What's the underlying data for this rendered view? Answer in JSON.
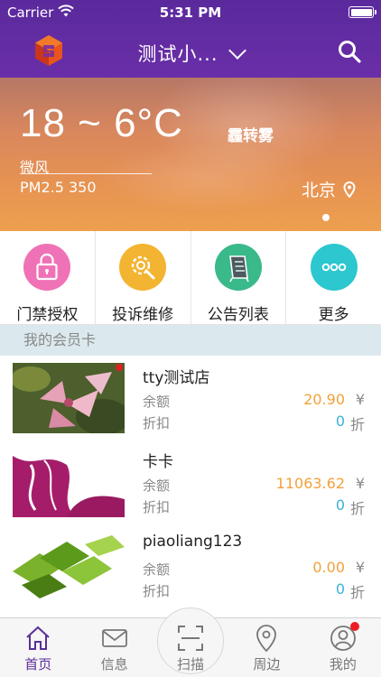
{
  "status_bar": {
    "carrier": "Carrier",
    "time": "5:31 PM"
  },
  "header": {
    "store_name": "测试小...",
    "icons": [
      "logo-icon",
      "chevron-down-icon",
      "search-icon"
    ]
  },
  "weather": {
    "temperature": "18 ~ 6°C",
    "condition": "霾转雾",
    "wind": "微风",
    "pm25": "PM2.5 350",
    "city": "北京"
  },
  "quick_actions": [
    {
      "label": "门禁授权",
      "icon": "lock-icon",
      "color": "#f072b6"
    },
    {
      "label": "投诉维修",
      "icon": "gear-wrench-icon",
      "color": "#f3b431"
    },
    {
      "label": "公告列表",
      "icon": "notice-board-icon",
      "color": "#3ab98a"
    },
    {
      "label": "更多",
      "icon": "more-icon",
      "color": "#2cc7cf"
    }
  ],
  "section": {
    "title": "我的会员卡"
  },
  "cards": [
    {
      "name": "tty测试店",
      "balance_label": "余额",
      "balance": "20.90",
      "balance_unit": "¥",
      "discount_label": "折扣",
      "discount": "0",
      "discount_unit": "折"
    },
    {
      "name": "卡卡",
      "balance_label": "余额",
      "balance": "11063.62",
      "balance_unit": "¥",
      "discount_label": "折扣",
      "discount": "0",
      "discount_unit": "折"
    },
    {
      "name": "piaoliang123",
      "balance_label": "余额",
      "balance": "0.00",
      "balance_unit": "¥",
      "discount_label": "折扣",
      "discount": "0",
      "discount_unit": "折"
    }
  ],
  "tabs": [
    {
      "label": "首页",
      "icon": "home-icon",
      "active": true
    },
    {
      "label": "信息",
      "icon": "mail-icon",
      "active": false
    },
    {
      "label": "扫描",
      "icon": "scan-icon",
      "active": false
    },
    {
      "label": "周边",
      "icon": "location-pin-icon",
      "active": false
    },
    {
      "label": "我的",
      "icon": "user-icon",
      "active": false
    }
  ],
  "colors": {
    "header": "#5a2a9c",
    "accent_orange": "#f2a13a",
    "accent_blue": "#39b3d9",
    "active_tab": "#5b2e99"
  }
}
